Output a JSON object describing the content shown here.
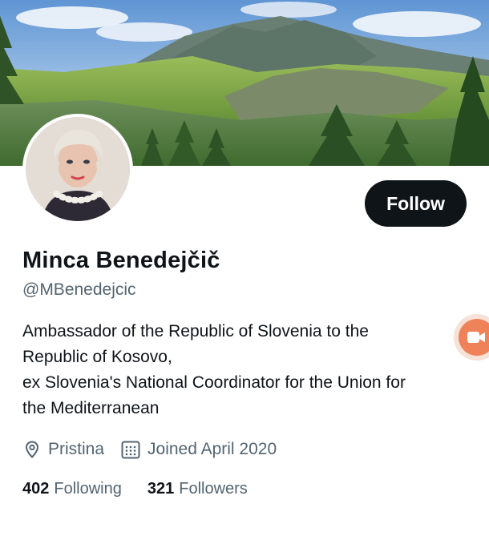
{
  "profile": {
    "display_name": "Minca Benedejčič",
    "handle": "@MBenedejcic",
    "bio_lines": [
      "Ambassador of the Republic of Slovenia to the",
      "Republic of Kosovo,",
      "ex Slovenia's National Coordinator for the Union for",
      "the Mediterranean"
    ],
    "location": "Pristina",
    "joined": "Joined April 2020",
    "following_count": "402",
    "following_label": "Following",
    "followers_count": "321",
    "followers_label": "Followers"
  },
  "actions": {
    "follow_label": "Follow"
  },
  "icons": {
    "location": "location-pin-icon",
    "joined": "calendar-icon",
    "floating": "video-camera-icon"
  },
  "colors": {
    "text_primary": "#0f1419",
    "text_secondary": "#536471",
    "follow_bg": "#0f1419",
    "floating_accent": "#f0825a"
  }
}
